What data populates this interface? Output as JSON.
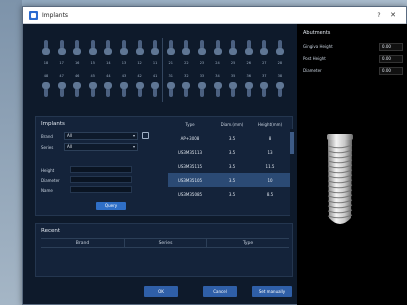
{
  "window": {
    "title": "Implants",
    "help": "?",
    "close": "✕"
  },
  "teeth": {
    "upper_numbers": [
      "18",
      "17",
      "16",
      "15",
      "14",
      "13",
      "12",
      "11",
      "21",
      "22",
      "23",
      "24",
      "25",
      "26",
      "27",
      "28"
    ],
    "lower_numbers": [
      "48",
      "47",
      "46",
      "45",
      "44",
      "43",
      "42",
      "41",
      "31",
      "32",
      "33",
      "34",
      "35",
      "36",
      "37",
      "38"
    ]
  },
  "implants": {
    "title": "Implants",
    "brand_label": "Brand",
    "brand_value": "All",
    "series_label": "Series",
    "series_value": "All",
    "height_label": "Height",
    "diameter_label": "Diameter",
    "name_label": "Name",
    "query_label": "Query",
    "columns": [
      "Type",
      "Diam.(mm)",
      "Height(mm)"
    ],
    "rows": [
      [
        "AP+3008",
        "3.5",
        "8"
      ],
      [
        "US3M35113",
        "3.5",
        "13"
      ],
      [
        "US3M35115",
        "3.5",
        "11.5"
      ],
      [
        "US3M35105",
        "3.5",
        "10"
      ],
      [
        "US3M35085",
        "3.5",
        "8.5"
      ]
    ],
    "selected_row": 3
  },
  "recent": {
    "title": "Recent",
    "columns": [
      "Brand",
      "Series",
      "Type"
    ]
  },
  "buttons": {
    "ok": "OK",
    "cancel": "Cancel",
    "set_manually": "Set manually"
  },
  "abutments": {
    "title": "Abutments",
    "rows": [
      {
        "label": "Gingiva Height",
        "value": "0.00"
      },
      {
        "label": "Post Height",
        "value": "0.00"
      },
      {
        "label": "Diameter",
        "value": "0.00"
      }
    ]
  },
  "colors": {
    "accent": "#2f6fc7",
    "panel": "#14233a",
    "background": "#0e1a2b",
    "selected": "#2b4a74"
  },
  "icons": {
    "edit": "edit-icon",
    "app": "app-icon"
  }
}
